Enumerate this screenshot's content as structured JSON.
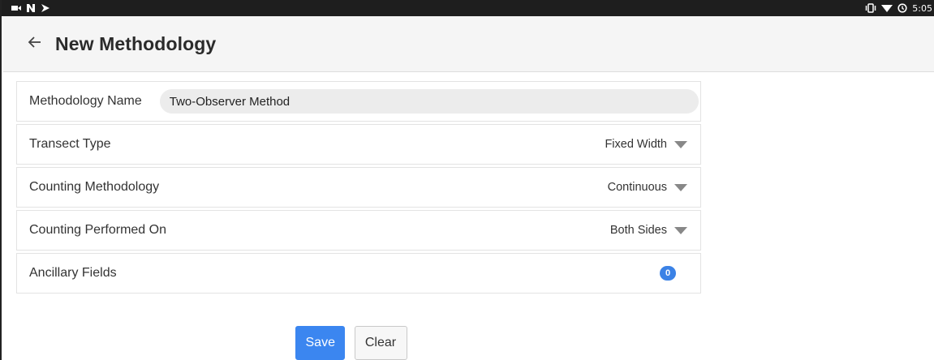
{
  "status_bar": {
    "left_icons": [
      "video-icon",
      "n-notification-icon",
      "download-notification-icon"
    ],
    "right_icons": [
      "vibrate-icon",
      "wifi-icon",
      "alarm-icon"
    ],
    "time": "5:05"
  },
  "app_bar": {
    "back_icon": "arrow-left-icon",
    "title": "New Methodology"
  },
  "form": {
    "methodology_name": {
      "label": "Methodology Name",
      "value": "Two-Observer Method",
      "placeholder": ""
    },
    "transect_type": {
      "label": "Transect Type",
      "value": "Fixed Width"
    },
    "counting_methodology": {
      "label": "Counting Methodology",
      "value": "Continuous"
    },
    "counting_performed_on": {
      "label": "Counting Performed On",
      "value": "Both Sides"
    },
    "ancillary_fields": {
      "label": "Ancillary Fields",
      "count": "0"
    }
  },
  "actions": {
    "save_label": "Save",
    "clear_label": "Clear"
  },
  "colors": {
    "status_bar": "#1e1e1e",
    "app_bar": "#f5f5f5",
    "accent": "#3b86f0",
    "badge": "#3b82e6"
  }
}
